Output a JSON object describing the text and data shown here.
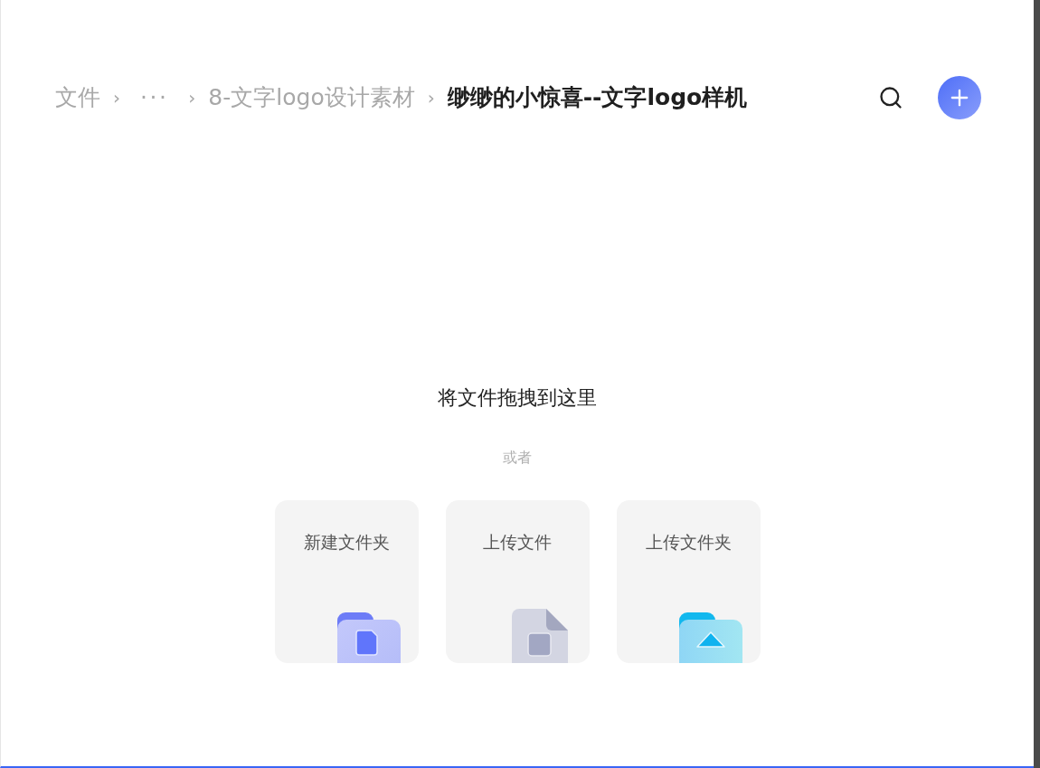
{
  "breadcrumb": [
    {
      "text": "文件",
      "kind": "link",
      "separator": "›"
    },
    {
      "text": "···",
      "kind": "ellipsis",
      "separator": "›"
    },
    {
      "text": "8-文字logo设计素材",
      "kind": "link",
      "separator": "›"
    },
    {
      "text": "缈缈的小惊喜--文字logo样机",
      "kind": "current"
    }
  ],
  "drop_zone": {
    "title": "将文件拖拽到这里",
    "or": "或者"
  },
  "actions": [
    {
      "label": "新建文件夹",
      "kind": "new-folder"
    },
    {
      "label": "上传文件",
      "kind": "upload-file"
    },
    {
      "label": "上传文件夹",
      "kind": "upload-folder"
    }
  ]
}
